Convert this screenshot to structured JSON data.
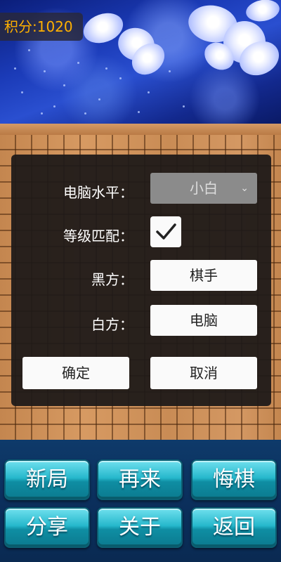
{
  "score": {
    "text": "积分:1020"
  },
  "dialog": {
    "level_label": "电脑水平：",
    "level_value": "小白",
    "match_label": "等级匹配：",
    "match_checked": true,
    "black_label": "黑方：",
    "black_value": "棋手",
    "white_label": "白方：",
    "white_value": "电脑",
    "confirm_label": "确定",
    "cancel_label": "取消"
  },
  "menu": {
    "new_game": "新局",
    "replay": "再来",
    "undo": "悔棋",
    "share": "分享",
    "about": "关于",
    "back": "返回"
  },
  "colors": {
    "score_text": "#ffb000",
    "dialog_bg": "#1e1a18",
    "button_cyan": "#26b8cc",
    "board_wood": "#c98c55"
  },
  "icons": {
    "checkmark": "checkmark-icon",
    "dropdown": "chevron-down-icon"
  }
}
